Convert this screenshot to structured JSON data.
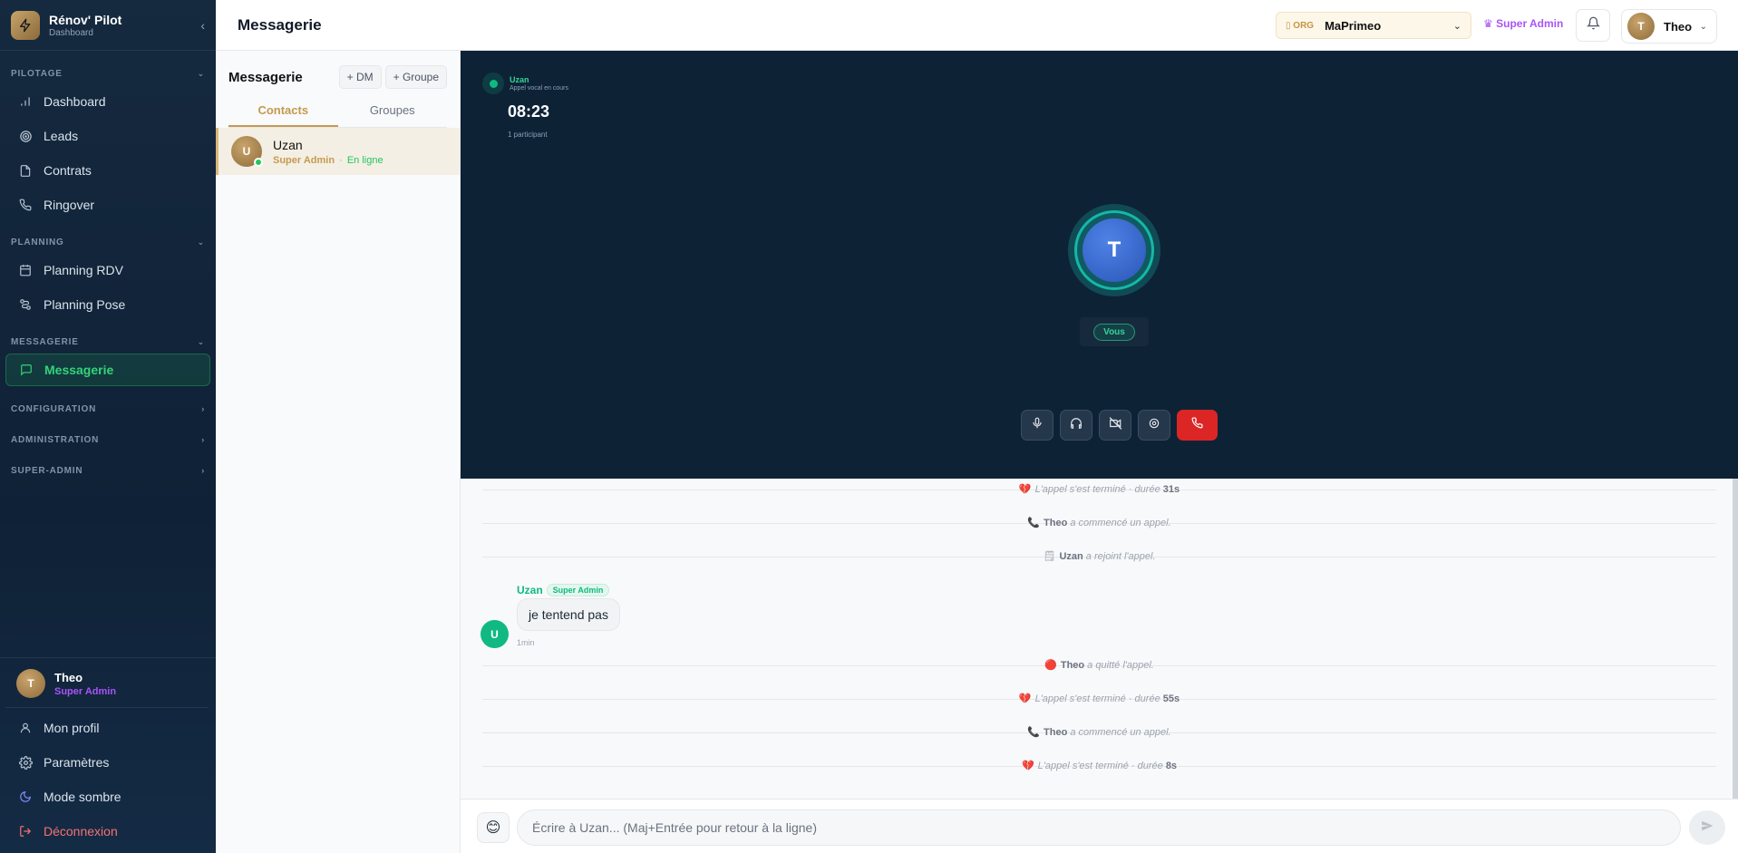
{
  "colors": {
    "sidebar_bg": "#0f2136",
    "accent_green": "#22c55e",
    "accent_gold": "#c59a50",
    "super_admin_purple": "#a855f7",
    "call_bg": "#0e2236",
    "hangup_red": "#dc2626"
  },
  "brand": {
    "name": "Rénov' Pilot",
    "subtitle": "Dashboard"
  },
  "sidebar": {
    "sections": [
      {
        "title": "PILOTAGE",
        "items": [
          {
            "label": "Dashboard",
            "icon": "chart-icon"
          },
          {
            "label": "Leads",
            "icon": "target-icon"
          },
          {
            "label": "Contrats",
            "icon": "document-icon"
          },
          {
            "label": "Ringover",
            "icon": "phone-icon"
          }
        ]
      },
      {
        "title": "PLANNING",
        "items": [
          {
            "label": "Planning RDV",
            "icon": "calendar-icon"
          },
          {
            "label": "Planning Pose",
            "icon": "workflow-icon"
          }
        ]
      },
      {
        "title": "MESSAGERIE",
        "items": [
          {
            "label": "Messagerie",
            "icon": "chat-icon",
            "active": true
          }
        ]
      },
      {
        "title": "CONFIGURATION",
        "items": []
      },
      {
        "title": "ADMINISTRATION",
        "items": []
      },
      {
        "title": "SUPER-ADMIN",
        "items": []
      }
    ],
    "user": {
      "initial": "T",
      "name": "Theo",
      "role": "Super Admin"
    },
    "bottom_items": [
      {
        "label": "Mon profil",
        "icon": "user-icon"
      },
      {
        "label": "Paramètres",
        "icon": "gear-icon"
      },
      {
        "label": "Mode sombre",
        "icon": "moon-icon"
      },
      {
        "label": "Déconnexion",
        "icon": "logout-icon"
      }
    ]
  },
  "header": {
    "title": "Messagerie",
    "org_tag": "ORG",
    "org_name": "MaPrimeo",
    "role_badge": "Super Admin",
    "user_initial": "T",
    "user_name": "Theo"
  },
  "conversations": {
    "title": "Messagerie",
    "dm_button": "+ DM",
    "group_button": "+ Groupe",
    "tabs": [
      "Contacts",
      "Groupes"
    ],
    "active_tab": "Contacts",
    "contacts": [
      {
        "initial": "U",
        "name": "Uzan",
        "role": "Super Admin",
        "separator": "·",
        "status": "En ligne"
      }
    ]
  },
  "call": {
    "caller": "Uzan",
    "state": "Appel vocal en cours",
    "timer": "08:23",
    "participants": "1 participant",
    "local_initial": "T",
    "local_label": "Vous"
  },
  "messages": {
    "events": [
      {
        "icon": "💔",
        "name": "",
        "text": "L'appel s'est terminé · durée ",
        "value": "31s"
      },
      {
        "icon": "📞",
        "name": "Theo",
        "text": " a commencé un appel.",
        "value": ""
      },
      {
        "icon": "🗒",
        "name": "Uzan",
        "text": " a rejoint l'appel.",
        "value": ""
      },
      {
        "icon": "🔴",
        "name": "Theo",
        "text": " a quitté l'appel.",
        "value": ""
      },
      {
        "icon": "💔",
        "name": "",
        "text": "L'appel s'est terminé · durée ",
        "value": "55s"
      },
      {
        "icon": "📞",
        "name": "Theo",
        "text": " a commencé un appel.",
        "value": ""
      },
      {
        "icon": "💔",
        "name": "",
        "text": "L'appel s'est terminé · durée ",
        "value": "8s"
      }
    ],
    "message": {
      "author_initial": "U",
      "author": "Uzan",
      "badge": "Super Admin",
      "text": "je tentend pas",
      "time": "1min"
    }
  },
  "composer": {
    "emoji": "😊",
    "placeholder": "Écrire à Uzan... (Maj+Entrée pour retour à la ligne)",
    "value": ""
  }
}
